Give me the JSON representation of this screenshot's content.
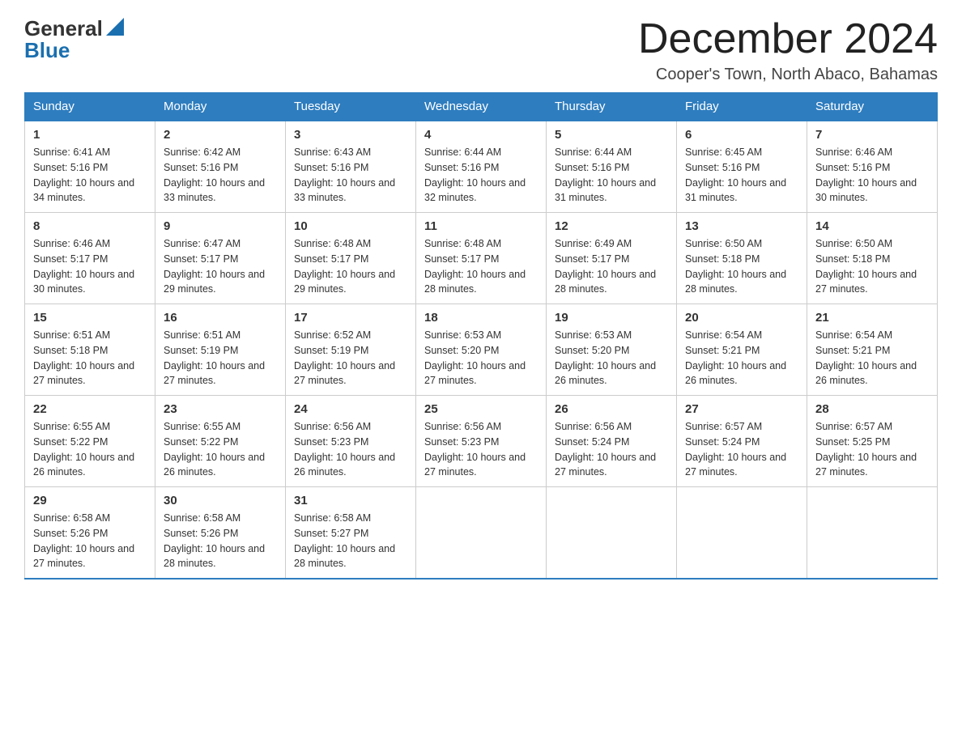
{
  "header": {
    "logo_general": "General",
    "logo_blue": "Blue",
    "month_title": "December 2024",
    "location": "Cooper's Town, North Abaco, Bahamas"
  },
  "weekdays": [
    "Sunday",
    "Monday",
    "Tuesday",
    "Wednesday",
    "Thursday",
    "Friday",
    "Saturday"
  ],
  "weeks": [
    [
      {
        "day": "1",
        "sunrise": "6:41 AM",
        "sunset": "5:16 PM",
        "daylight": "10 hours and 34 minutes."
      },
      {
        "day": "2",
        "sunrise": "6:42 AM",
        "sunset": "5:16 PM",
        "daylight": "10 hours and 33 minutes."
      },
      {
        "day": "3",
        "sunrise": "6:43 AM",
        "sunset": "5:16 PM",
        "daylight": "10 hours and 33 minutes."
      },
      {
        "day": "4",
        "sunrise": "6:44 AM",
        "sunset": "5:16 PM",
        "daylight": "10 hours and 32 minutes."
      },
      {
        "day": "5",
        "sunrise": "6:44 AM",
        "sunset": "5:16 PM",
        "daylight": "10 hours and 31 minutes."
      },
      {
        "day": "6",
        "sunrise": "6:45 AM",
        "sunset": "5:16 PM",
        "daylight": "10 hours and 31 minutes."
      },
      {
        "day": "7",
        "sunrise": "6:46 AM",
        "sunset": "5:16 PM",
        "daylight": "10 hours and 30 minutes."
      }
    ],
    [
      {
        "day": "8",
        "sunrise": "6:46 AM",
        "sunset": "5:17 PM",
        "daylight": "10 hours and 30 minutes."
      },
      {
        "day": "9",
        "sunrise": "6:47 AM",
        "sunset": "5:17 PM",
        "daylight": "10 hours and 29 minutes."
      },
      {
        "day": "10",
        "sunrise": "6:48 AM",
        "sunset": "5:17 PM",
        "daylight": "10 hours and 29 minutes."
      },
      {
        "day": "11",
        "sunrise": "6:48 AM",
        "sunset": "5:17 PM",
        "daylight": "10 hours and 28 minutes."
      },
      {
        "day": "12",
        "sunrise": "6:49 AM",
        "sunset": "5:17 PM",
        "daylight": "10 hours and 28 minutes."
      },
      {
        "day": "13",
        "sunrise": "6:50 AM",
        "sunset": "5:18 PM",
        "daylight": "10 hours and 28 minutes."
      },
      {
        "day": "14",
        "sunrise": "6:50 AM",
        "sunset": "5:18 PM",
        "daylight": "10 hours and 27 minutes."
      }
    ],
    [
      {
        "day": "15",
        "sunrise": "6:51 AM",
        "sunset": "5:18 PM",
        "daylight": "10 hours and 27 minutes."
      },
      {
        "day": "16",
        "sunrise": "6:51 AM",
        "sunset": "5:19 PM",
        "daylight": "10 hours and 27 minutes."
      },
      {
        "day": "17",
        "sunrise": "6:52 AM",
        "sunset": "5:19 PM",
        "daylight": "10 hours and 27 minutes."
      },
      {
        "day": "18",
        "sunrise": "6:53 AM",
        "sunset": "5:20 PM",
        "daylight": "10 hours and 27 minutes."
      },
      {
        "day": "19",
        "sunrise": "6:53 AM",
        "sunset": "5:20 PM",
        "daylight": "10 hours and 26 minutes."
      },
      {
        "day": "20",
        "sunrise": "6:54 AM",
        "sunset": "5:21 PM",
        "daylight": "10 hours and 26 minutes."
      },
      {
        "day": "21",
        "sunrise": "6:54 AM",
        "sunset": "5:21 PM",
        "daylight": "10 hours and 26 minutes."
      }
    ],
    [
      {
        "day": "22",
        "sunrise": "6:55 AM",
        "sunset": "5:22 PM",
        "daylight": "10 hours and 26 minutes."
      },
      {
        "day": "23",
        "sunrise": "6:55 AM",
        "sunset": "5:22 PM",
        "daylight": "10 hours and 26 minutes."
      },
      {
        "day": "24",
        "sunrise": "6:56 AM",
        "sunset": "5:23 PM",
        "daylight": "10 hours and 26 minutes."
      },
      {
        "day": "25",
        "sunrise": "6:56 AM",
        "sunset": "5:23 PM",
        "daylight": "10 hours and 27 minutes."
      },
      {
        "day": "26",
        "sunrise": "6:56 AM",
        "sunset": "5:24 PM",
        "daylight": "10 hours and 27 minutes."
      },
      {
        "day": "27",
        "sunrise": "6:57 AM",
        "sunset": "5:24 PM",
        "daylight": "10 hours and 27 minutes."
      },
      {
        "day": "28",
        "sunrise": "6:57 AM",
        "sunset": "5:25 PM",
        "daylight": "10 hours and 27 minutes."
      }
    ],
    [
      {
        "day": "29",
        "sunrise": "6:58 AM",
        "sunset": "5:26 PM",
        "daylight": "10 hours and 27 minutes."
      },
      {
        "day": "30",
        "sunrise": "6:58 AM",
        "sunset": "5:26 PM",
        "daylight": "10 hours and 28 minutes."
      },
      {
        "day": "31",
        "sunrise": "6:58 AM",
        "sunset": "5:27 PM",
        "daylight": "10 hours and 28 minutes."
      },
      null,
      null,
      null,
      null
    ]
  ],
  "labels": {
    "sunrise_prefix": "Sunrise: ",
    "sunset_prefix": "Sunset: ",
    "daylight_prefix": "Daylight: "
  }
}
